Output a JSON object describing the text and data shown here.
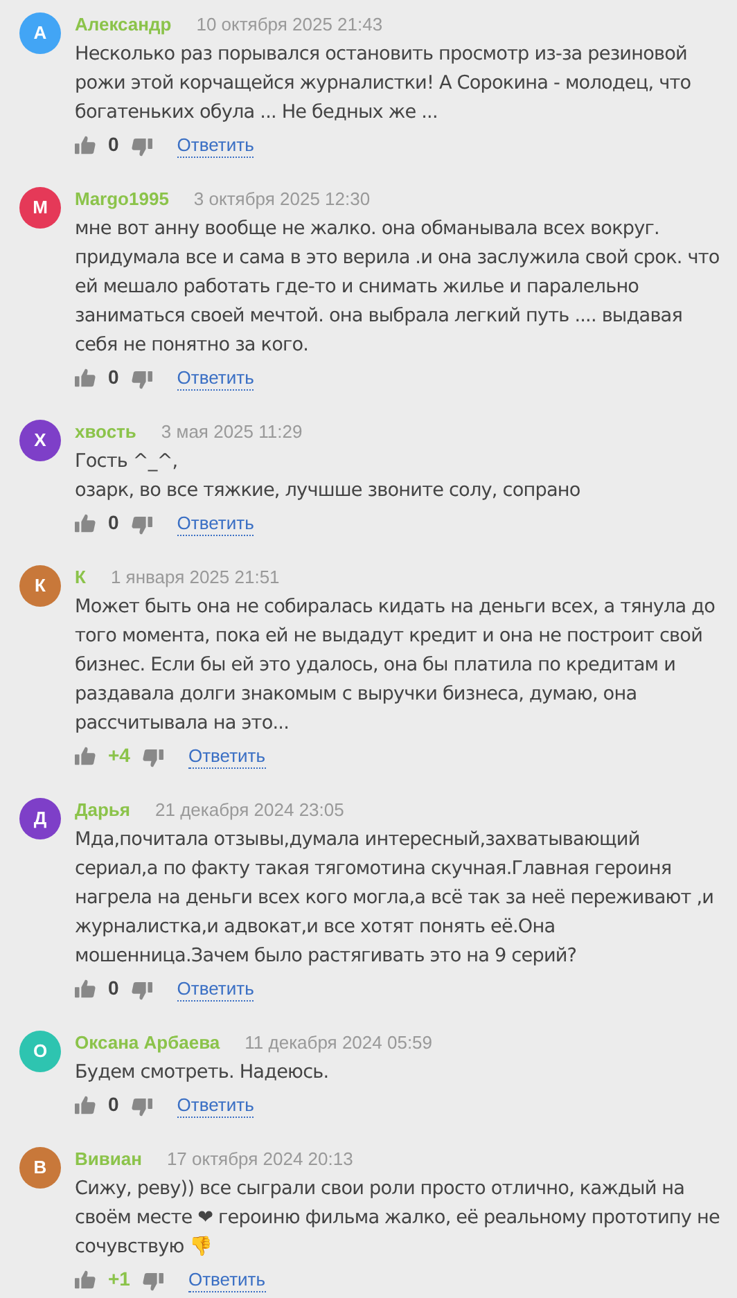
{
  "comments": [
    {
      "initial": "А",
      "color": "#42a5f5",
      "author": "Александр",
      "date": "10 октября 2025 21:43",
      "body": [
        "Несколько раз порывался остановить просмотр из-за резиновой рожи этой корчащейся журналистки! А Сорокина - молодец, что богатеньких обула ... Не бедных же ..."
      ],
      "score": "0",
      "positive": false,
      "reply": "Ответить"
    },
    {
      "initial": "M",
      "color": "#e53958",
      "author": "Margo1995",
      "date": "3 октября 2025 12:30",
      "body": [
        "мне вот анну вообще не жалко. она обманывала всех вокруг. придумала все и сама в это верила .и она заслужила свой срок. что ей мешало работать где-то и снимать жилье и паралельно заниматься своей мечтой. она выбрала легкий путь .... выдавая себя не понятно за кого."
      ],
      "score": "0",
      "positive": false,
      "reply": "Ответить"
    },
    {
      "initial": "Х",
      "color": "#7e3fc8",
      "author": "хвость",
      "date": "3 мая 2025 11:29",
      "body": [
        "Гость ^_^,",
        "озарк, во все тяжкие, лучшше звоните солу, сопрано"
      ],
      "score": "0",
      "positive": false,
      "reply": "Ответить"
    },
    {
      "initial": "К",
      "color": "#c8783a",
      "author": "К",
      "date": "1 января 2025 21:51",
      "body": [
        "Может быть она не собиралась кидать на деньги всех, а тянула до того момента, пока ей не выдадут кредит и она не построит свой бизнес. Если бы ей это удалось, она бы платила по кредитам и раздавала долги знакомым с выручки бизнеса, думаю, она рассчитывала на это..."
      ],
      "score": "+4",
      "positive": true,
      "reply": "Ответить"
    },
    {
      "initial": "Д",
      "color": "#7e3fc8",
      "author": "Дарья",
      "date": "21 декабря 2024 23:05",
      "body": [
        "Мда,почитала отзывы,думала интересный,захватывающий сериал,а по факту такая тягомотина скучная.Главная героиня нагрела на деньги всех кого могла,а всё так за неё переживают ,и журналистка,и адвокат,и все хотят понять её.Она мошенница.Зачем было растягивать это на 9 серий?"
      ],
      "score": "0",
      "positive": false,
      "reply": "Ответить"
    },
    {
      "initial": "О",
      "color": "#2ec4b0",
      "author": "Оксана Арбаева",
      "date": "11 декабря 2024 05:59",
      "body": [
        "Будем смотреть. Надеюсь."
      ],
      "score": "0",
      "positive": false,
      "reply": "Ответить"
    },
    {
      "initial": "В",
      "color": "#c8783a",
      "author": "Вивиан",
      "date": "17 октября 2024 20:13",
      "body": [
        "Сижу, реву)) все сыграли свои роли просто отлично, каждый на своём месте ❤ героиню фильма жалко, её реальному прототипу не сочувствую 👎"
      ],
      "score": "+1",
      "positive": true,
      "reply": "Ответить"
    }
  ]
}
